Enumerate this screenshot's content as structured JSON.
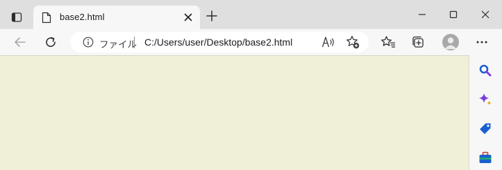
{
  "tab": {
    "title": "base2.html"
  },
  "addressbar": {
    "site_label": "ファイル",
    "url": "C:/Users/user/Desktop/base2.html"
  },
  "icons": {
    "tab_actions": "tab-actions-icon",
    "favicon": "file-icon",
    "close": "close-icon",
    "new_tab": "plus-icon",
    "minimize": "minimize-icon",
    "maximize": "maximize-icon",
    "window_close": "window-close-icon",
    "back": "back-arrow-icon",
    "refresh": "refresh-icon",
    "info": "info-icon",
    "read_aloud": "read-aloud-icon",
    "add_favorite": "add-favorite-icon",
    "favorites": "favorites-icon",
    "collections": "collections-icon",
    "profile": "profile-avatar",
    "more": "more-icon",
    "sidebar_search": "search-icon",
    "sidebar_copilot": "sparkle-icon",
    "sidebar_shopping": "tag-icon",
    "sidebar_tools": "toolbox-icon"
  },
  "colors": {
    "page_background": "#f0f0d8",
    "tabstrip": "#dfdfdf",
    "toolbar": "#f7f7f7",
    "accent_blue": "#1a5fd0",
    "accent_purple": "#7a3fe0"
  }
}
